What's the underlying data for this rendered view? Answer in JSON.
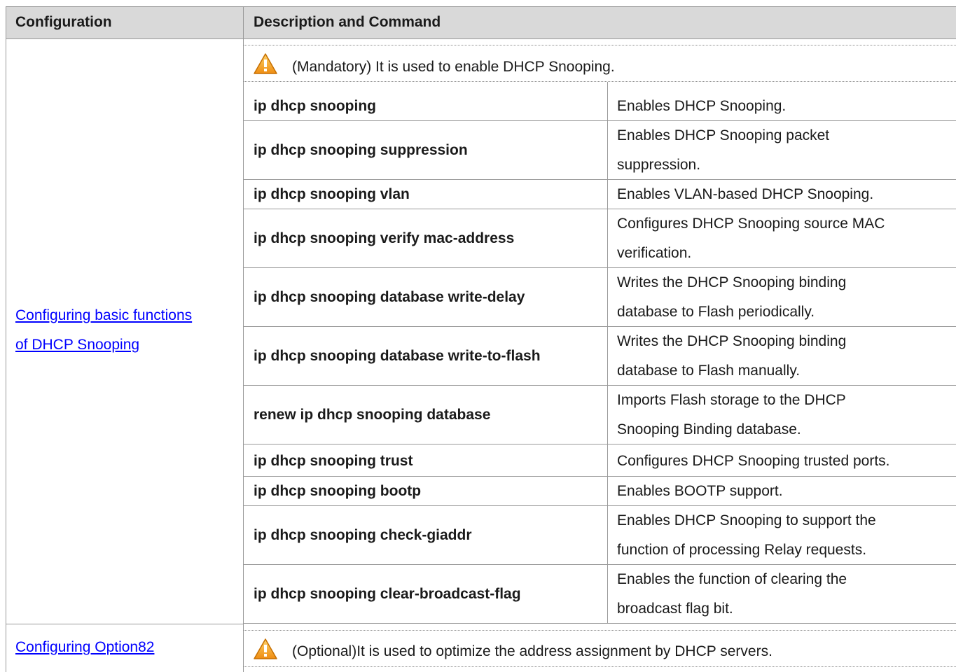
{
  "table": {
    "headers": [
      "Configuration",
      "Description and Command"
    ],
    "sections": [
      {
        "config_link": [
          "Configuring basic functions ",
          "of DHCP Snooping"
        ],
        "note": "(Mandatory) It is used to enable DHCP Snooping.",
        "rows": [
          {
            "command": "ip dhcp snooping",
            "description": [
              "Enables DHCP Snooping."
            ]
          },
          {
            "command": "ip dhcp snooping suppression",
            "description": [
              "Enables DHCP Snooping packet",
              "suppression."
            ]
          },
          {
            "command": "ip dhcp snooping vlan",
            "description": [
              "Enables VLAN-based DHCP Snooping."
            ]
          },
          {
            "command": "ip dhcp snooping verify mac-address",
            "description": [
              "Configures DHCP Snooping source MAC",
              "verification."
            ]
          },
          {
            "command": "ip dhcp snooping database write-delay",
            "description": [
              "Writes the DHCP Snooping binding",
              "database to Flash periodically."
            ]
          },
          {
            "command": "ip dhcp snooping database write-to-flash",
            "description": [
              "Writes the DHCP Snooping binding",
              "database to Flash manually."
            ]
          },
          {
            "command": "renew ip dhcp snooping database",
            "description": [
              "Imports Flash storage to the DHCP",
              "Snooping Binding database."
            ]
          },
          {
            "command": "ip dhcp snooping trust",
            "description": [
              "Configures DHCP Snooping trusted ports."
            ]
          },
          {
            "command": "ip dhcp snooping bootp",
            "description": [
              "Enables BOOTP support."
            ]
          },
          {
            "command": "ip dhcp snooping check-giaddr",
            "description": [
              "Enables DHCP Snooping to support the",
              "function of processing Relay requests."
            ]
          },
          {
            "command": "ip dhcp snooping clear-broadcast-flag",
            "description": [
              "Enables the function of clearing the",
              "broadcast flag bit."
            ]
          }
        ]
      },
      {
        "config_link": [
          "Configuring Option82"
        ],
        "note": "(Optional)It is used to optimize the address assignment by DHCP servers.",
        "rows": []
      }
    ]
  },
  "colors": {
    "header_bg": "#d9d9d9",
    "link": "#0000ff",
    "warning": "#f5a623"
  }
}
